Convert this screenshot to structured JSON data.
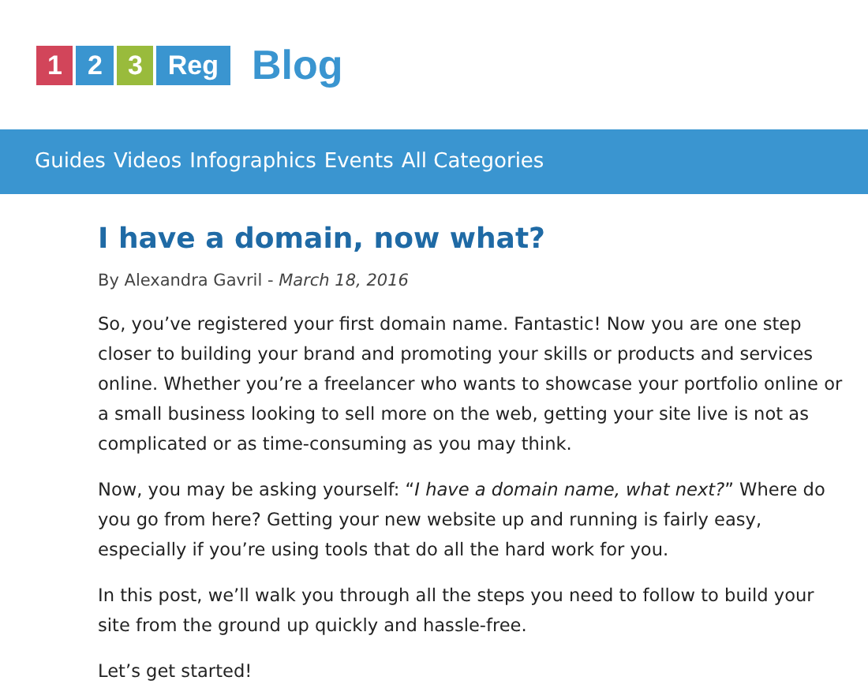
{
  "logo": {
    "tiles": [
      {
        "text": "1",
        "color": "#d2455a"
      },
      {
        "text": "2",
        "color": "#3a95d0"
      },
      {
        "text": "3",
        "color": "#99bb3c"
      },
      {
        "text": "Reg",
        "color": "#3a95d0"
      }
    ],
    "label": "Blog"
  },
  "nav": [
    "Guides",
    "Videos",
    "Infographics",
    "Events",
    "All Categories"
  ],
  "article": {
    "title": "I have a domain, now what?",
    "byline": "By Alexandra Gavril - *March 18, 2016*",
    "paragraphs": [
      "So, you’ve registered your first domain name. Fantastic! Now you are one step closer to building your brand and promoting your skills or products and services online. Whether you’re a freelancer who wants to showcase your portfolio online or a small business looking to sell more on the web, getting your site live is not as complicated or as time-consuming as you may think.",
      "Now, you may be asking yourself: “*I have a domain name, what next?*” Where do you go from here? Getting your new website up and running is fairly easy, especially if you’re using tools that do all the hard work for you.",
      "In this post, we’ll walk you through all the steps you need to follow to build your site from the ground up quickly and hassle-free.",
      "Let’s get started!"
    ]
  }
}
